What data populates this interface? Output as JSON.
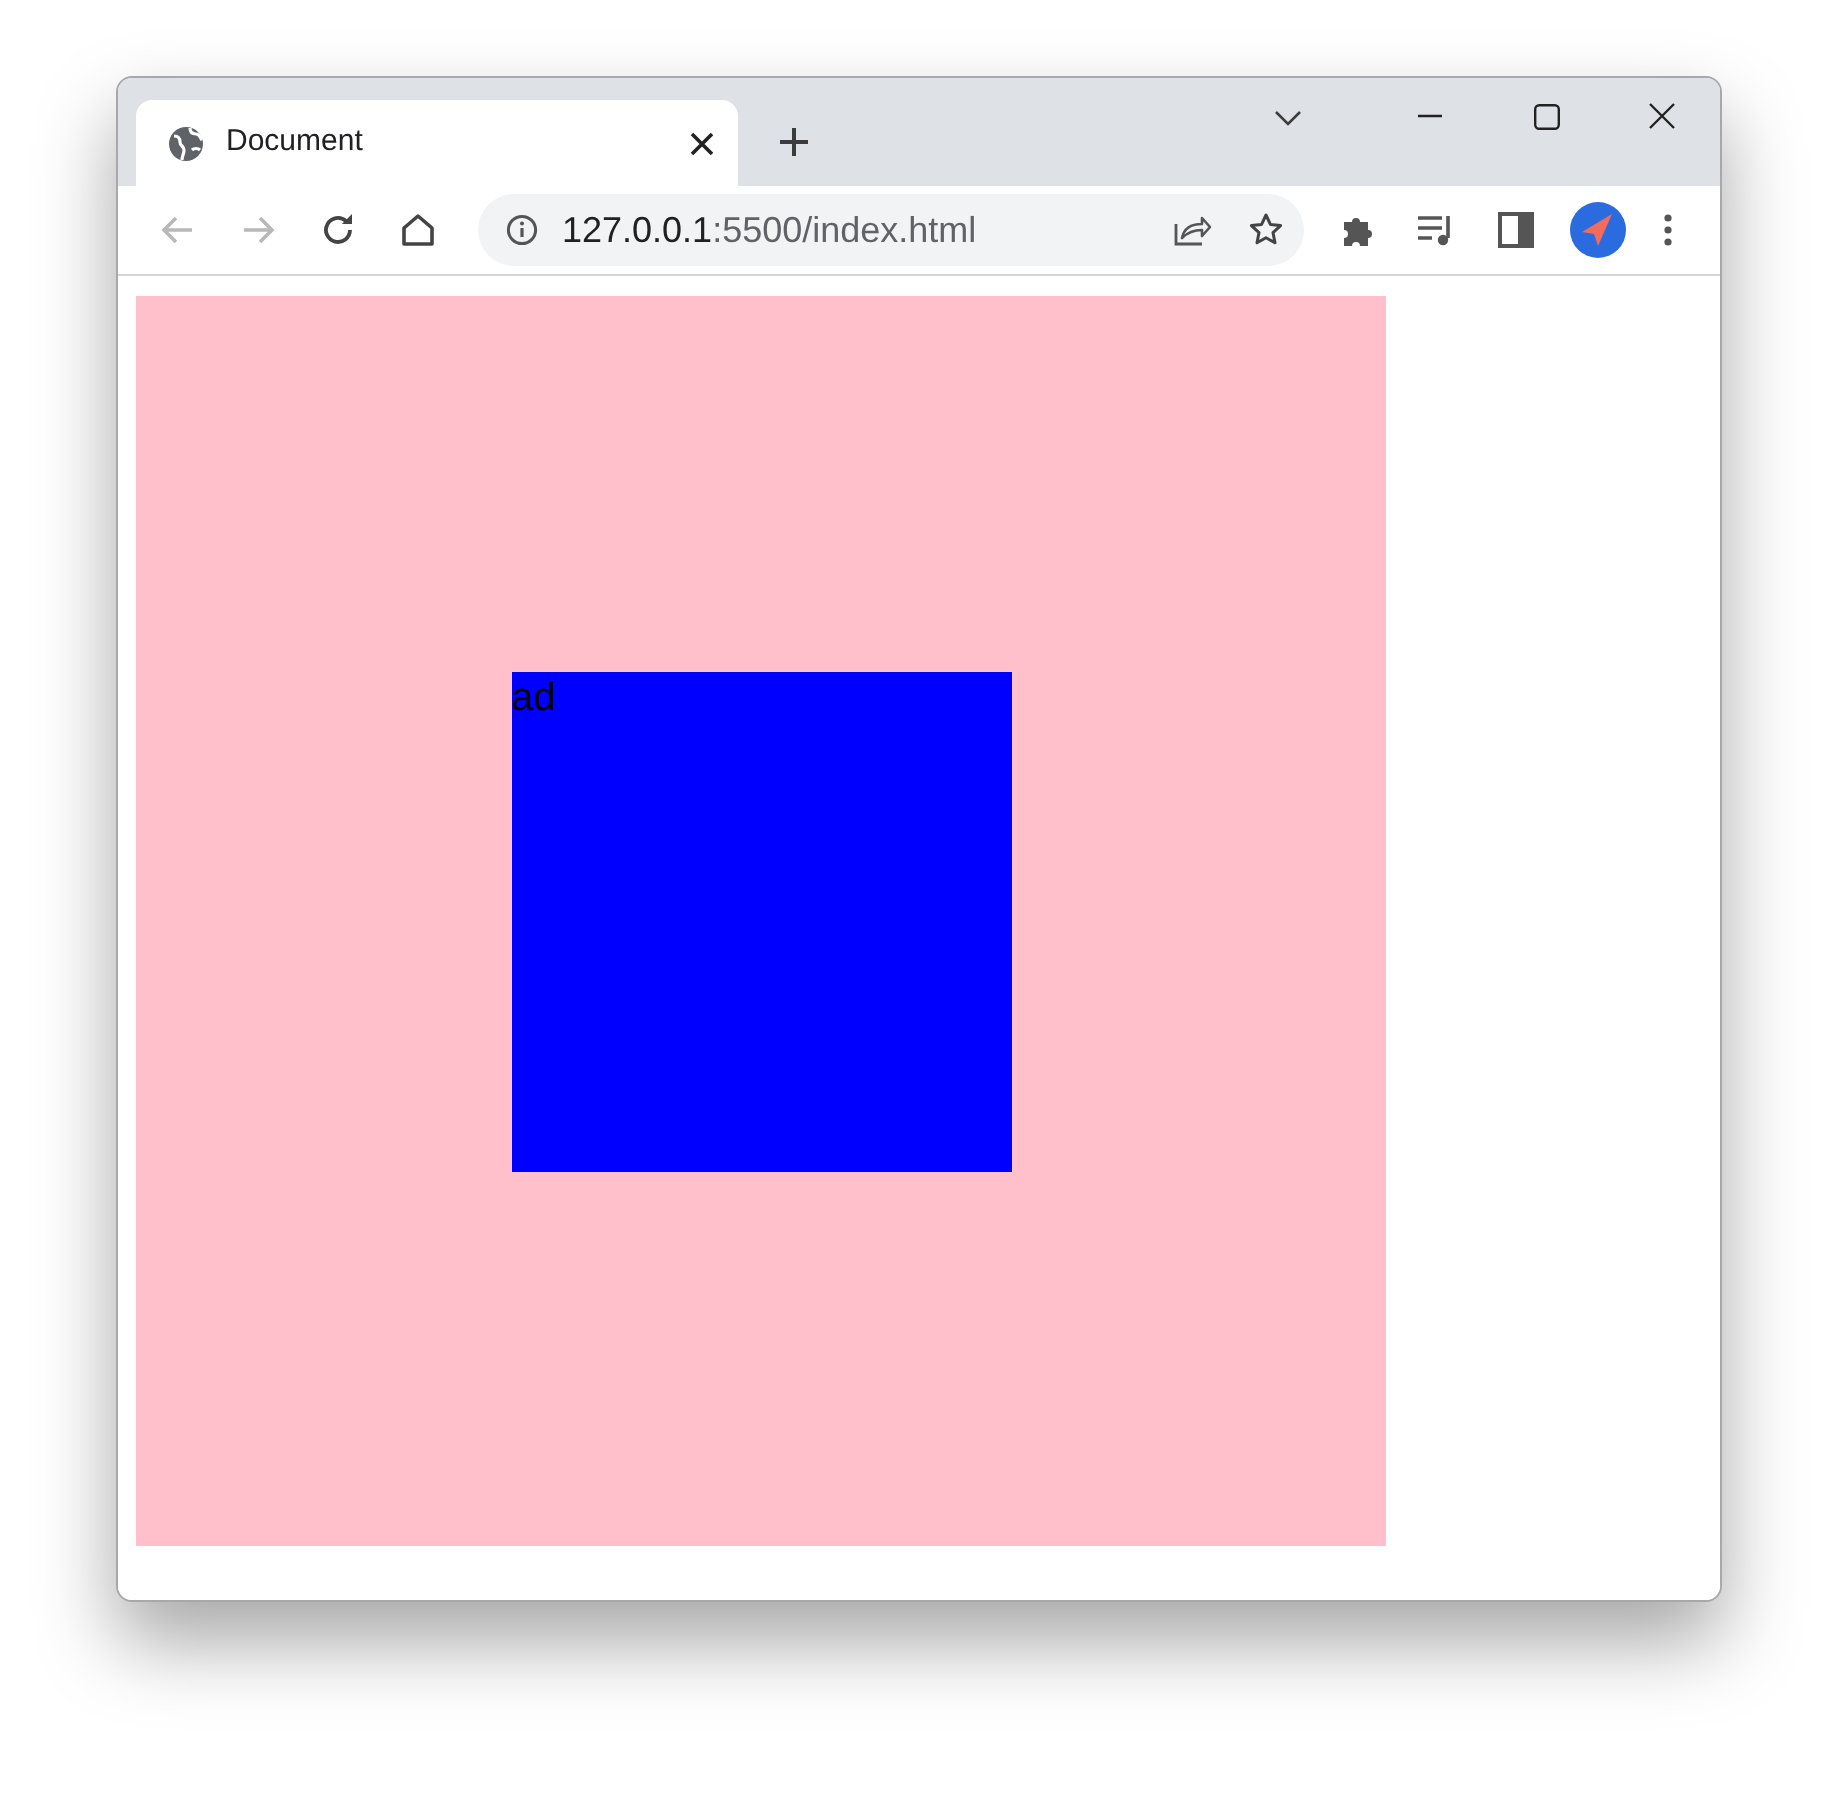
{
  "tabs": [
    {
      "title": "Document",
      "selected": true
    }
  ],
  "nav_buttons": [
    {
      "kind": "back",
      "disabled": true
    },
    {
      "kind": "forward",
      "disabled": true
    },
    {
      "kind": "reload",
      "disabled": false
    },
    {
      "kind": "home",
      "disabled": false
    }
  ],
  "address_bar": {
    "host": "127.0.0.1",
    "path": ":5500/index.html"
  },
  "page": {
    "inner_box": {
      "text": "ad"
    }
  }
}
